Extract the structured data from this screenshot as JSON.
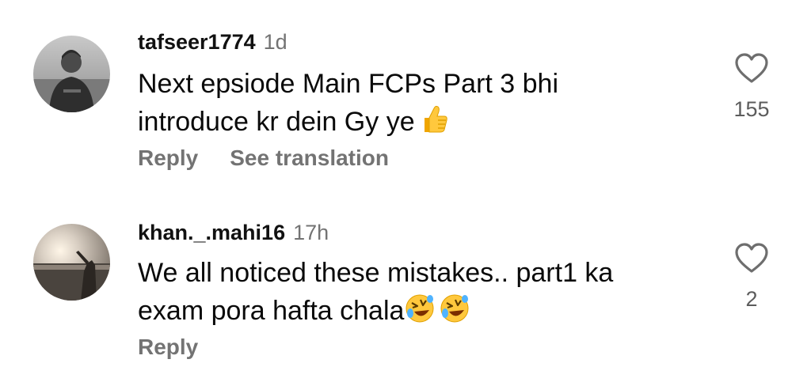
{
  "colors": {
    "username": "#111111",
    "meta": "#737373",
    "text": "#0a0a0a",
    "like_count": "#5c5c5c"
  },
  "comments": [
    {
      "username": "tafseer1774",
      "time": "1d",
      "lines": [
        "Next epsiode Main FCPs Part 3 bhi",
        "introduce kr dein Gy ye"
      ],
      "emojis": [
        "thumbs-up-emoji"
      ],
      "actions": {
        "reply": "Reply",
        "see_translation": "See translation"
      },
      "likes": "155",
      "icons": {
        "like": "heart-outline-icon"
      }
    },
    {
      "username": "khan._.mahi16",
      "time": "17h",
      "lines": [
        "We all noticed these mistakes.. part1 ka",
        "exam pora hafta chala"
      ],
      "emojis": [
        "rolling-on-floor-laughing-emoji",
        "rolling-on-floor-laughing-emoji"
      ],
      "actions": {
        "reply": "Reply"
      },
      "likes": "2",
      "icons": {
        "like": "heart-outline-icon"
      }
    }
  ]
}
